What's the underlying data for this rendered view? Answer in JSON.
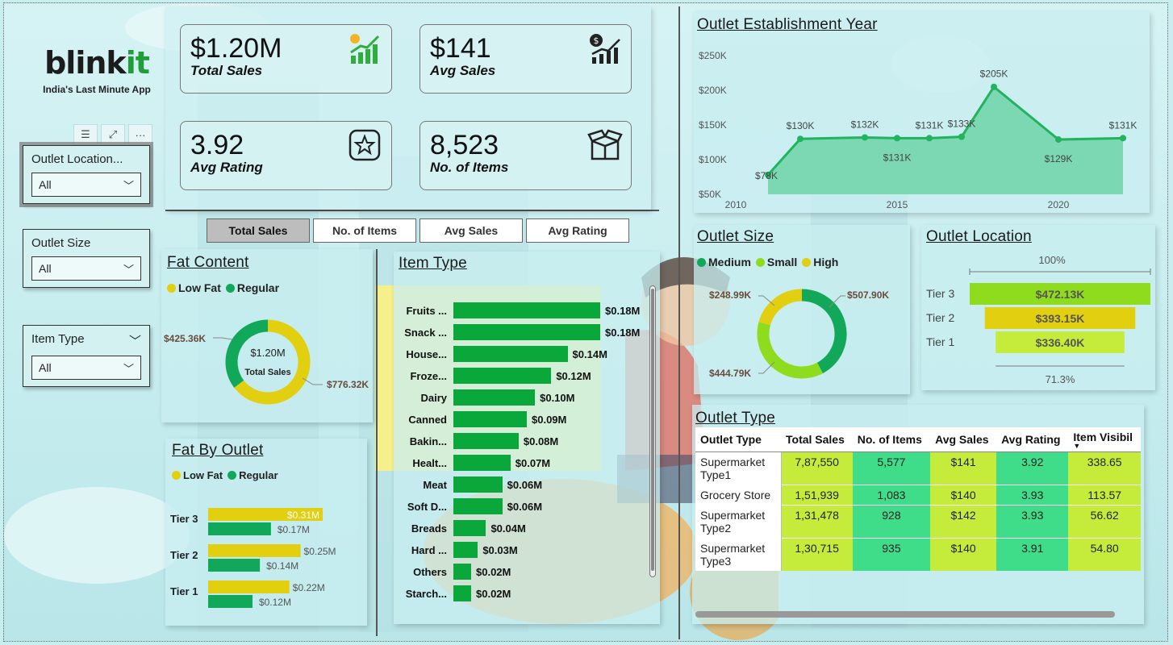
{
  "brand": {
    "name_main": "blink",
    "name_accent": "it",
    "tagline": "India's Last Minute App"
  },
  "toolbar_icons": [
    "filter-icon",
    "focus-mode-icon",
    "more-options-icon"
  ],
  "slicers": [
    {
      "title": "Outlet Location...",
      "value": "All"
    },
    {
      "title": "Outlet Size",
      "value": "All"
    },
    {
      "title": "Item Type",
      "value": "All"
    }
  ],
  "kpis": [
    {
      "value": "$1.20M",
      "label": "Total Sales",
      "icon": "growth-chart-icon"
    },
    {
      "value": "$141",
      "label": "Avg Sales",
      "icon": "dollar-chart-icon"
    },
    {
      "value": "3.92",
      "label": "Avg Rating",
      "icon": "star-icon"
    },
    {
      "value": "8,523",
      "label": "No. of Items",
      "icon": "box-icon"
    }
  ],
  "tabs": [
    "Total Sales",
    "No. of Items",
    "Avg Sales",
    "Avg Rating"
  ],
  "active_tab": "Total Sales",
  "fat_content": {
    "title": "Fat Content",
    "legend": [
      "Low Fat",
      "Regular"
    ],
    "center_value": "$1.20M",
    "center_label": "Total Sales",
    "labels": [
      "$776.32K",
      "$425.36K"
    ],
    "chart_data": {
      "type": "pie",
      "categories": [
        "Low Fat",
        "Regular"
      ],
      "values": [
        776.32,
        425.36
      ],
      "unit": "K"
    }
  },
  "fat_by_outlet": {
    "title": "Fat By Outlet",
    "legend": [
      "Low Fat",
      "Regular"
    ],
    "tiers": [
      "Tier 3",
      "Tier 2",
      "Tier 1"
    ],
    "low_fat_labels": [
      "$0.31M",
      "$0.25M",
      "$0.22M"
    ],
    "regular_labels": [
      "$0.17M",
      "$0.14M",
      "$0.12M"
    ],
    "chart_data": {
      "type": "bar",
      "categories": [
        "Tier 3",
        "Tier 2",
        "Tier 1"
      ],
      "series": [
        {
          "name": "Low Fat",
          "values": [
            0.31,
            0.25,
            0.22
          ]
        },
        {
          "name": "Regular",
          "values": [
            0.17,
            0.14,
            0.12
          ]
        }
      ],
      "unit": "M"
    }
  },
  "item_type": {
    "title": "Item Type",
    "chart_data": {
      "type": "bar",
      "categories": [
        "Fruits ...",
        "Snack ...",
        "House...",
        "Froze...",
        "Dairy",
        "Canned",
        "Bakin...",
        "Healt...",
        "Meat",
        "Soft D...",
        "Breads",
        "Hard ...",
        "Others",
        "Starch..."
      ],
      "values": [
        0.18,
        0.18,
        0.14,
        0.12,
        0.1,
        0.09,
        0.08,
        0.07,
        0.06,
        0.06,
        0.04,
        0.03,
        0.02,
        0.02
      ],
      "labels": [
        "$0.18M",
        "$0.18M",
        "$0.14M",
        "$0.12M",
        "$0.10M",
        "$0.09M",
        "$0.08M",
        "$0.07M",
        "$0.06M",
        "$0.06M",
        "$0.04M",
        "$0.03M",
        "$0.02M",
        "$0.02M"
      ],
      "unit": "M"
    }
  },
  "establishment": {
    "title": "Outlet Establishment Year",
    "y_ticks": [
      "$250K",
      "$200K",
      "$150K",
      "$100K",
      "$50K"
    ],
    "x_ticks": [
      "2010",
      "2015",
      "2020"
    ],
    "chart_data": {
      "type": "area",
      "x": [
        2011,
        2012,
        2014,
        2015,
        2016,
        2017,
        2018,
        2020,
        2022
      ],
      "values": [
        78,
        130,
        132,
        131,
        131,
        133,
        205,
        129,
        131
      ],
      "labels": [
        "$78K",
        "$130K",
        "$132K",
        "$131K",
        "$131K",
        "$133K",
        "$205K",
        "$129K",
        "$131K"
      ],
      "ylim": [
        50,
        250
      ],
      "xlim": [
        2010,
        2022
      ],
      "unit": "K"
    }
  },
  "outlet_size": {
    "title": "Outlet Size",
    "legend": [
      "Medium",
      "Small",
      "High"
    ],
    "labels": [
      "$507.90K",
      "$444.79K",
      "$248.99K"
    ],
    "chart_data": {
      "type": "pie",
      "categories": [
        "Medium",
        "Small",
        "High"
      ],
      "values": [
        507.9,
        444.79,
        248.99
      ],
      "unit": "K"
    }
  },
  "outlet_location": {
    "title": "Outlet Location",
    "top_pct": "100%",
    "bottom_pct": "71.3%",
    "chart_data": {
      "type": "bar",
      "categories": [
        "Tier 3",
        "Tier 2",
        "Tier 1"
      ],
      "values": [
        472.13,
        393.15,
        336.4
      ],
      "labels": [
        "$472.13K",
        "$393.15K",
        "$336.40K"
      ],
      "unit": "K"
    }
  },
  "outlet_type": {
    "title": "Outlet Type",
    "columns": [
      "Outlet Type",
      "Total Sales",
      "No. of Items",
      "Avg Sales",
      "Avg Rating",
      "Item Visibil"
    ],
    "rows": [
      [
        "Supermarket Type1",
        "7,87,550",
        "5,577",
        "$141",
        "3.92",
        "338.65"
      ],
      [
        "Grocery Store",
        "1,51,939",
        "1,083",
        "$140",
        "3.93",
        "113.57"
      ],
      [
        "Supermarket Type2",
        "1,31,478",
        "928",
        "$142",
        "3.93",
        "56.62"
      ],
      [
        "Supermarket Type3",
        "1,30,715",
        "935",
        "$140",
        "3.91",
        "54.80"
      ]
    ]
  },
  "colors": {
    "green": "#0aa83a",
    "lowfat_yellow": "#e2cf10",
    "regular_green": "#12a85a",
    "lime": "#c5ec3a",
    "mint": "#3fdc8a",
    "area_fill": "#6fd3a8",
    "line": "#22b35e"
  }
}
